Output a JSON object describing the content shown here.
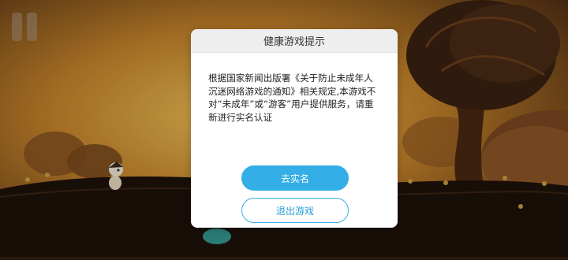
{
  "dialog": {
    "title": "健康游戏提示",
    "message": "根据国家新闻出版署《关于防止未成年人沉迷网络游戏的通知》相关规定,本游戏不对“未成年”或“游客”用户提供服务，请重新进行实名认证",
    "verify_label": "去实名",
    "exit_label": "退出游戏"
  },
  "hud": {
    "pause_icon": "pause-icon"
  },
  "colors": {
    "accent": "#33aee6",
    "sky": "#c98a2e",
    "ground": "#1e120a"
  }
}
